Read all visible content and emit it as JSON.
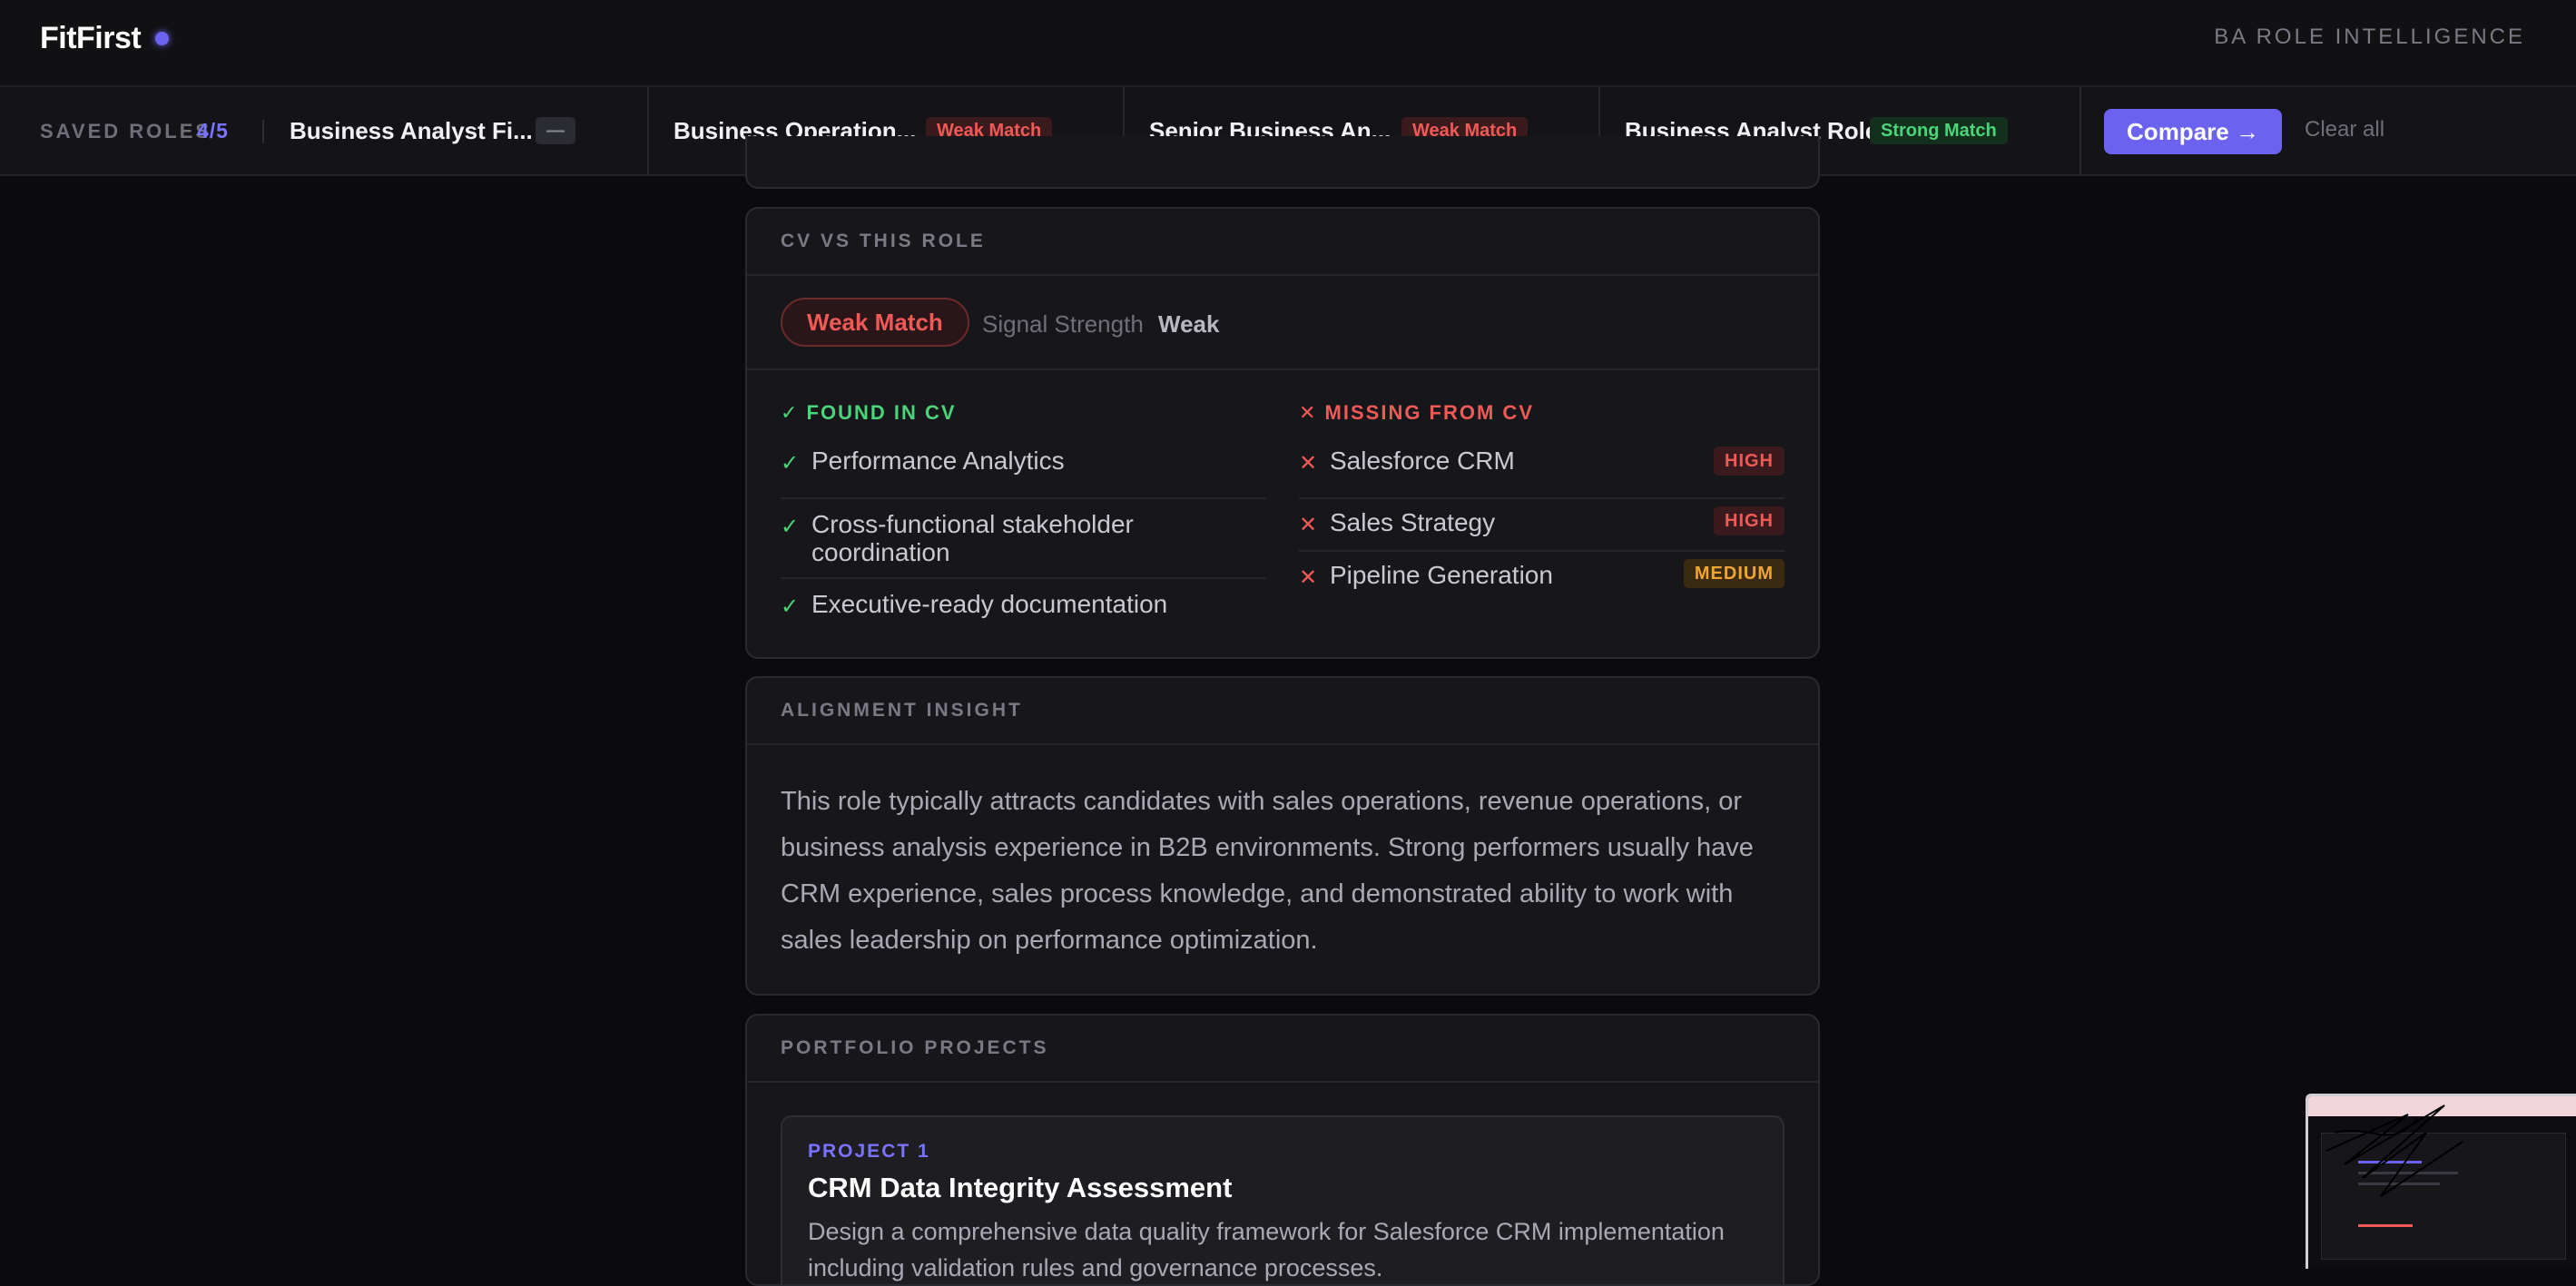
{
  "app": {
    "name": "FitFirst",
    "tagline": "BA ROLE INTELLIGENCE"
  },
  "roles_bar": {
    "label": "SAVED ROLES",
    "count": "4/5",
    "tabs": [
      {
        "name": "Business Analyst Fi...",
        "badge": "—",
        "badge_type": "none"
      },
      {
        "name": "Business Operation...",
        "badge": "Weak Match",
        "badge_type": "weak"
      },
      {
        "name": "Senior Business An...",
        "badge": "Weak Match",
        "badge_type": "weak"
      },
      {
        "name": "Business Analyst Role",
        "badge": "Strong Match",
        "badge_type": "strong"
      }
    ],
    "compare_label": "Compare →",
    "clear_label": "Clear all"
  },
  "cv_card": {
    "title": "CV VS THIS ROLE",
    "match_label": "Weak Match",
    "signal_label": "Signal Strength",
    "signal_value": "Weak",
    "found_title": "✓ FOUND IN CV",
    "missing_title": "✕ MISSING FROM CV",
    "found": [
      "Performance Analytics",
      "Cross-functional stakeholder coordination",
      "Executive-ready documentation"
    ],
    "missing": [
      {
        "name": "Salesforce CRM",
        "priority": "HIGH"
      },
      {
        "name": "Sales Strategy",
        "priority": "HIGH"
      },
      {
        "name": "Pipeline Generation",
        "priority": "MEDIUM"
      }
    ]
  },
  "insight_card": {
    "title": "ALIGNMENT INSIGHT",
    "text": "This role typically attracts candidates with sales operations, revenue operations, or business analysis experience in B2B environments. Strong performers usually have CRM experience, sales process knowledge, and demonstrated ability to work with sales leadership on performance optimization."
  },
  "portfolio_card": {
    "title": "PORTFOLIO PROJECTS",
    "projects": [
      {
        "number": "PROJECT 1",
        "title": "CRM Data Integrity Assessment",
        "description": "Design a comprehensive data quality framework for Salesforce CRM implementation including validation rules and governance processes."
      }
    ]
  },
  "colors": {
    "accent": "#6b63f0",
    "weak": "#ef5a56",
    "strong": "#4bd478",
    "medium": "#f0a532",
    "background": "#0b0b0d"
  }
}
